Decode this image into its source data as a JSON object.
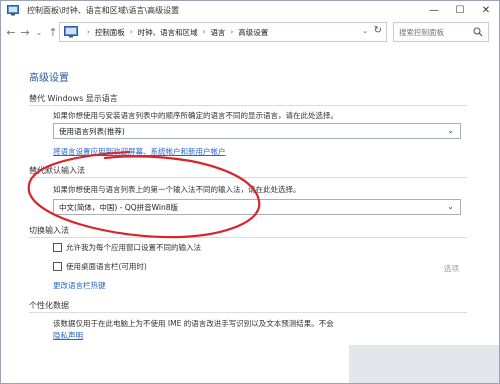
{
  "window": {
    "title": "控制面板\\时钟、语言和区域\\语言\\高级设置",
    "minimize": "—",
    "maximize": "☐",
    "close": "✕"
  },
  "nav": {
    "back": "←",
    "forward": "→",
    "recent": "⌄",
    "up": "↑",
    "crumbs": [
      "控制面板",
      "时钟、语言和区域",
      "语言",
      "高级设置"
    ],
    "search_placeholder": "搜索控制面板"
  },
  "page": {
    "title": "高级设置",
    "override_display": {
      "heading": "替代 Windows 显示语言",
      "desc": "如果你想使用与安装语言列表中的顺序所确定的语言不同的显示语言，请在此处选择。",
      "select_value": "使用语言列表(推荐)",
      "link": "将语言设置应用到欢迎屏幕、系统帐户和新用户帐户"
    },
    "override_input": {
      "heading": "替代默认输入法",
      "desc": "如果你想使用与语言列表上的第一个输入法不同的输入法，请在此处选择。",
      "select_value": "中文(简体，中国) - QQ拼音Win8版"
    },
    "switch_input": {
      "heading": "切换输入法",
      "check1": "允许我为每个应用窗口设置不同的输入法",
      "check2": "使用桌面语言栏(可用时)",
      "options": "选项",
      "link": "更改语言栏热键"
    },
    "personalization": {
      "heading": "个性化数据",
      "desc": "该数据仅用于在此电脑上为不使用 IME 的语言改进手写识别以及文本预测结果。不会",
      "link": "隐私声明"
    }
  },
  "annotation_color": "#d9242b"
}
